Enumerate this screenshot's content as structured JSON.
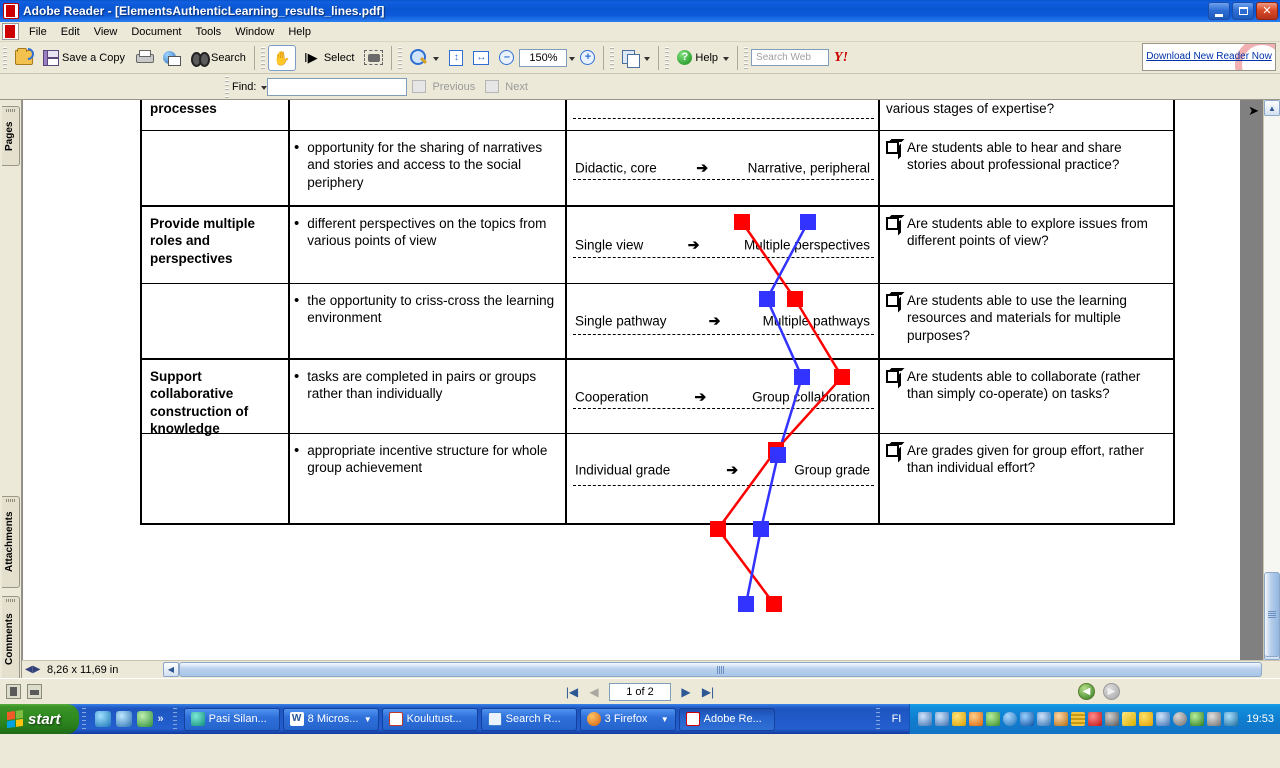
{
  "window": {
    "title": "Adobe Reader - [ElementsAuthenticLearning_results_lines.pdf]",
    "minimize": "_",
    "maximize": "□",
    "close": "✕"
  },
  "menu": {
    "items": [
      "File",
      "Edit",
      "View",
      "Document",
      "Tools",
      "Window",
      "Help"
    ]
  },
  "toolbar": {
    "open_label": "",
    "save_label": "Save a Copy",
    "print_label": "",
    "email_label": "",
    "search_label": "Search",
    "hand_label": "",
    "select_label": "Select",
    "snapshot_label": "",
    "zoom_label": "",
    "zoom_value": "150%",
    "minus_label": "–",
    "plus_label": "+",
    "pages_label": "",
    "help_label": "Help",
    "search_web_placeholder": "Search Web",
    "yahoo_label": "Y!",
    "download_banner": "Download New Reader Now"
  },
  "findbar": {
    "label": "Find:",
    "value": "",
    "previous_label": "Previous",
    "next_label": "Next"
  },
  "navpane": {
    "tabs": [
      "Pages",
      "Attachments",
      "Comments"
    ]
  },
  "statusbar": {
    "page_size": "8,26 x 11,69 in",
    "page_indicator": "1 of 2",
    "first_label": "|◀",
    "prev_label": "◀",
    "next_label": "▶",
    "last_label": "▶|",
    "back_label": "◀",
    "forward_label": "▶"
  },
  "taskbar": {
    "start_label": "start",
    "language": "FI",
    "clock": "19:53",
    "tasks": [
      {
        "label": "Pasi Silan...",
        "color": "#16a085"
      },
      {
        "label": "8 Micros...",
        "color": "#2b579a",
        "has_arrow": true
      },
      {
        "label": "Koulutust...",
        "color": "#c0392b"
      },
      {
        "label": "Search R...",
        "color": "#3f7fd0"
      },
      {
        "label": "3 Firefox",
        "color": "#e8730a",
        "has_arrow": true
      },
      {
        "label": "Adobe Re...",
        "color": "#cc0000",
        "active": true
      }
    ]
  },
  "document": {
    "rows": [
      {
        "category": "processes",
        "category_partial": true,
        "bullet": "",
        "scale_left": "",
        "scale_right": "",
        "question": "various stages of expertise?",
        "has_checkbox": false
      },
      {
        "category": "",
        "bullet": "opportunity for the sharing of narratives and stories and access to the social periphery",
        "scale_left": "Didactic, core",
        "scale_right": "Narrative, peripheral",
        "question": "Are students able to hear and share stories about professional practice?",
        "has_checkbox": true
      },
      {
        "category": "Provide multiple roles and perspectives",
        "bullet": "different perspectives on the topics from various points of view",
        "scale_left": "Single view",
        "scale_right": "Multiple perspectives",
        "question": "Are students able to explore issues from different points of view?",
        "has_checkbox": true
      },
      {
        "category": "",
        "bullet": "the opportunity to criss-cross the learning environment",
        "scale_left": "Single pathway",
        "scale_right": "Multiple pathways",
        "question": "Are students able to use the learning resources and materials for multiple purposes?",
        "has_checkbox": true
      },
      {
        "category": "Support collaborative construction of knowledge",
        "bullet": "tasks are completed in pairs or groups rather than individually",
        "scale_left": "Cooperation",
        "scale_right": "Group collaboration",
        "question": "Are students able to collaborate (rather than simply co-operate) on tasks?",
        "has_checkbox": true
      },
      {
        "category": "",
        "bullet": "appropriate incentive structure for whole group achievement",
        "scale_left": "Individual grade",
        "scale_right": "Group grade",
        "question": "Are grades given for group effort, rather than individual effort?",
        "has_checkbox": true
      }
    ],
    "arrow_glyph": "➔"
  },
  "chart_data": {
    "type": "line",
    "title": "",
    "xlabel": "",
    "ylabel": "",
    "colors": {
      "series_1": "#ff0000",
      "series_2": "#3333ff"
    },
    "categories": [
      "Didactic, core → Narrative, peripheral",
      "Single view → Multiple perspectives",
      "Single pathway → Multiple pathways",
      "Cooperation → Group collaboration",
      "Individual grade → Group grade"
    ],
    "series": [
      {
        "name": "red",
        "color": "#ff0000",
        "points": [
          {
            "x": 719,
            "y": 122
          },
          {
            "x": 772,
            "y": 199
          },
          {
            "x": 819,
            "y": 277
          },
          {
            "x": 753,
            "y": 350
          },
          {
            "x": 695,
            "y": 429
          },
          {
            "x": 751,
            "y": 504
          }
        ]
      },
      {
        "name": "blue",
        "color": "#3333ff",
        "points": [
          {
            "x": 785,
            "y": 122
          },
          {
            "x": 744,
            "y": 199
          },
          {
            "x": 779,
            "y": 277
          },
          {
            "x": 755,
            "y": 355
          },
          {
            "x": 738,
            "y": 429
          },
          {
            "x": 723,
            "y": 504
          }
        ]
      }
    ],
    "marker": "square",
    "marker_size": 16,
    "grid": false,
    "legend": "none"
  }
}
